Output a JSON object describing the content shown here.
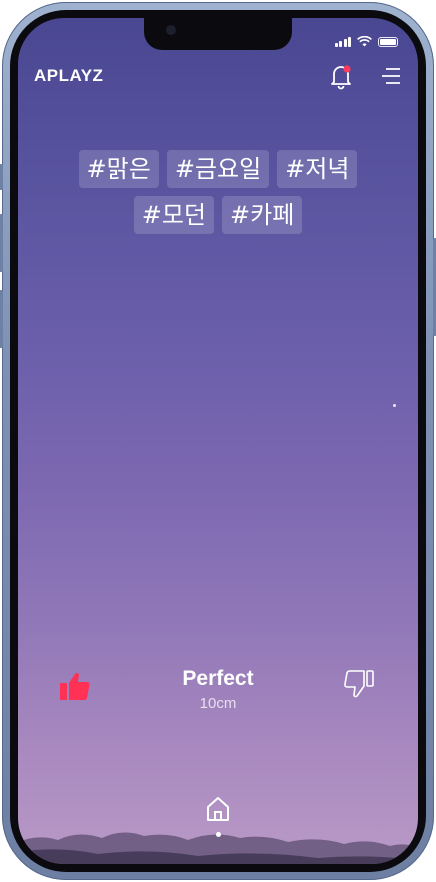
{
  "app": {
    "logo": "APLAYZ"
  },
  "header": {
    "bell_icon": "bell-icon",
    "menu_icon": "menu-icon",
    "notification_color": "#ff3b5c"
  },
  "mood_tags": {
    "row1": [
      "#맑은",
      "#금요일",
      "#저녁"
    ],
    "row2": [
      "#모던",
      "#카페"
    ]
  },
  "now_playing": {
    "title": "Perfect",
    "artist": "10cm"
  },
  "actions": {
    "like_icon": "thumbs-up-icon",
    "dislike_icon": "thumbs-down-icon",
    "like_color": "#ff3155"
  },
  "bottom_nav": {
    "home_icon": "home-icon"
  }
}
